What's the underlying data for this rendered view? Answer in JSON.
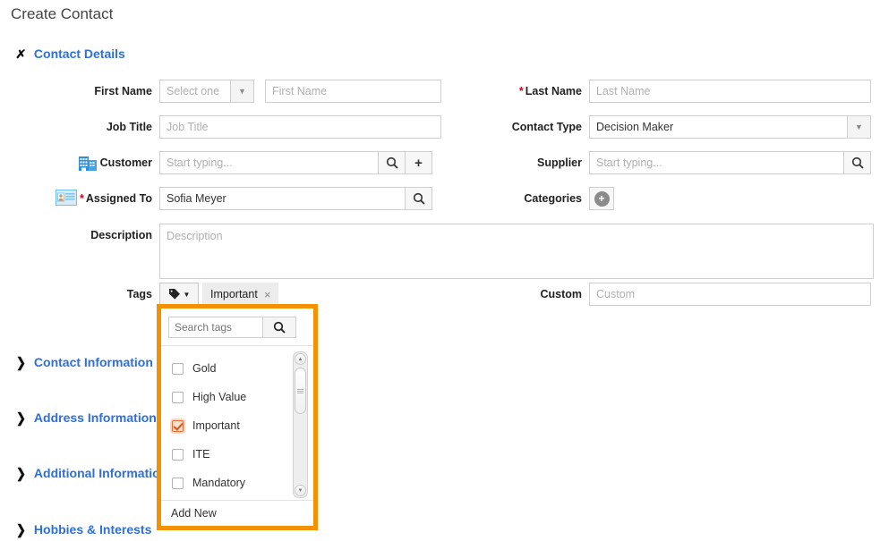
{
  "page": {
    "title": "Create Contact"
  },
  "sections": [
    {
      "name": "contact-details",
      "label": "Contact Details",
      "expanded": true,
      "chevron": "chevron-down-icon"
    },
    {
      "name": "contact-information",
      "label": "Contact Information",
      "expanded": false,
      "chevron": "chevron-right-icon"
    },
    {
      "name": "address-information",
      "label": "Address Information",
      "expanded": false,
      "chevron": "chevron-right-icon"
    },
    {
      "name": "additional-information",
      "label": "Additional Information",
      "expanded": false,
      "chevron": "chevron-right-icon"
    },
    {
      "name": "hobbies-interests",
      "label": "Hobbies & Interests",
      "expanded": false,
      "chevron": "chevron-right-icon"
    }
  ],
  "form": {
    "first_name": {
      "label": "First Name",
      "salutation_value": "Select one",
      "salutation_options": [
        "Select one"
      ],
      "value": "",
      "placeholder": "First Name"
    },
    "last_name": {
      "label": "Last Name",
      "required": "*",
      "value": "",
      "placeholder": "Last Name"
    },
    "job_title": {
      "label": "Job Title",
      "value": "",
      "placeholder": "Job Title"
    },
    "contact_type": {
      "label": "Contact Type",
      "value": "Decision Maker",
      "options": [
        "Decision Maker"
      ]
    },
    "customer": {
      "label": "Customer",
      "icon": "office-building-icon",
      "value": "",
      "placeholder": "Start typing...",
      "search_button": "search-icon",
      "add_button": "plus-icon"
    },
    "supplier": {
      "label": "Supplier",
      "value": "",
      "placeholder": "Start typing...",
      "search_button": "search-icon"
    },
    "assigned_to": {
      "label": "Assigned To",
      "required": "*",
      "icon": "contact-card-icon",
      "value": "Sofia Meyer",
      "search_button": "search-icon"
    },
    "categories": {
      "label": "Categories",
      "add_button": "plus-circle-icon"
    },
    "description": {
      "label": "Description",
      "value": "",
      "placeholder": "Description"
    },
    "tags": {
      "label": "Tags",
      "button_icon": "tag-icon",
      "chips": [
        {
          "label": "Important",
          "remove": "×"
        }
      ]
    },
    "custom": {
      "label": "Custom",
      "value": "",
      "placeholder": "Custom"
    }
  },
  "tag_dropdown": {
    "search_value": "",
    "search_placeholder": "Search tags",
    "search_icon": "search-icon",
    "items": [
      {
        "label": "Gold",
        "checked": false
      },
      {
        "label": "High Value",
        "checked": false
      },
      {
        "label": "Important",
        "checked": true
      },
      {
        "label": "ITE",
        "checked": false
      },
      {
        "label": "Mandatory",
        "checked": false
      }
    ],
    "add_new_label": "Add New",
    "scroll_up_icon": "caret-up-icon",
    "scroll_down_icon": "caret-down-icon",
    "highlight_color": "#F39200"
  }
}
